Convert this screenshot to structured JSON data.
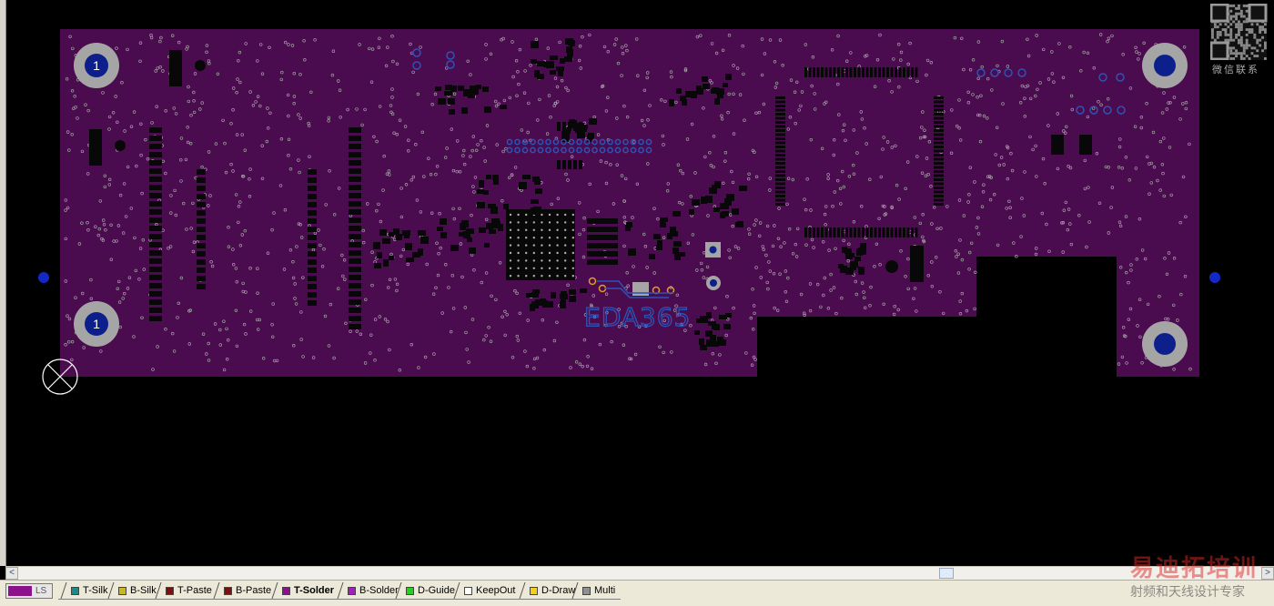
{
  "colors": {
    "board_fill": "#4b0c4f",
    "board_edge": "#3c0a40",
    "pad_dark": "#080808",
    "via_silver": "#b0b0b0",
    "mount_gray": "#a5a5a5",
    "mount_blue": "#0c1f8a",
    "fiducial_blue": "#1428c8",
    "copper_orange": "#e09a2a",
    "cutout_black": "#000000",
    "label_blue": "#2d53b5"
  },
  "board": {
    "mount_hole_labels": [
      "1",
      "1"
    ],
    "watermark_text": "EDA365"
  },
  "qr": {
    "caption": "微信联系"
  },
  "scroll": {
    "left_arrow": "<",
    "right_arrow": ">"
  },
  "layer_bar": {
    "current_layer": "LS",
    "tabs": [
      {
        "label": "T-Silk",
        "color": "#1a8a8a",
        "active": false
      },
      {
        "label": "B-Silk",
        "color": "#c8b820",
        "active": false
      },
      {
        "label": "T-Paste",
        "color": "#7a1010",
        "active": false
      },
      {
        "label": "B-Paste",
        "color": "#7a1010",
        "active": false
      },
      {
        "label": "T-Solder",
        "color": "#8b128b",
        "active": true
      },
      {
        "label": "B-Solder",
        "color": "#a020c0",
        "active": false
      },
      {
        "label": "D-Guide",
        "color": "#22d022",
        "active": false
      },
      {
        "label": "KeepOut",
        "color": "#ffffff",
        "active": false
      },
      {
        "label": "D-Draw",
        "color": "#f0d020",
        "active": false
      },
      {
        "label": "Multi",
        "color": "#909090",
        "active": false
      }
    ]
  },
  "watermark": {
    "logo_text": "易迪拓培训",
    "sub_text": "射频和天线设计专家"
  }
}
